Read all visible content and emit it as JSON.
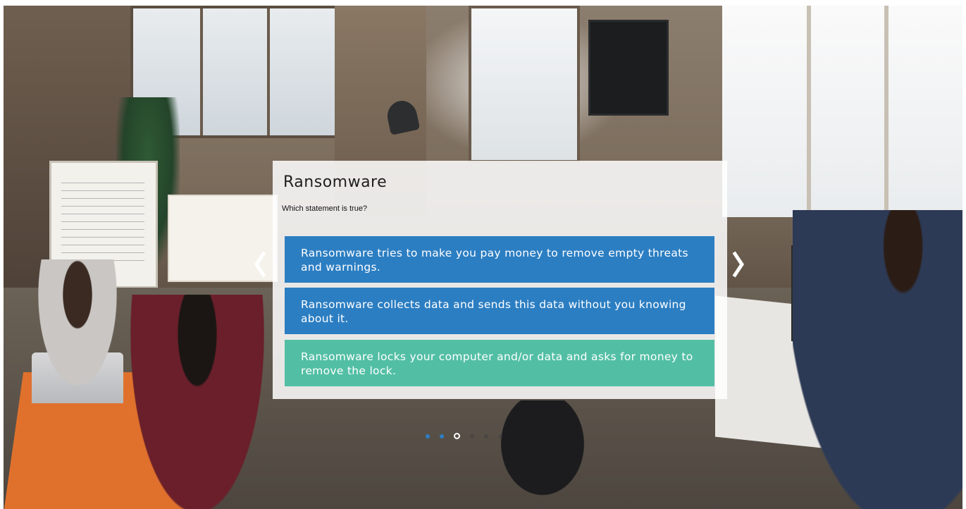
{
  "slide": {
    "title": "Ransomware",
    "question": "Which statement is true?",
    "answers": [
      {
        "label": "Ransomware tries to make you pay money to remove empty threats and warnings.",
        "color": "#2c7ec2"
      },
      {
        "label": "Ransomware collects data and sends this data without you knowing about it.",
        "color": "#2c7ec2"
      },
      {
        "label": "Ransomware locks your computer and/or data and asks for money to remove the lock.",
        "color": "#52bfa5"
      }
    ]
  },
  "navigation": {
    "prev_icon": "chevron-left-icon",
    "next_icon": "chevron-right-icon",
    "pager": {
      "total": 6,
      "current": 3,
      "completed": 2
    }
  },
  "colors": {
    "answer_default": "#2c7ec2",
    "answer_selected": "#52bfa5",
    "card_background": "#ffffff"
  }
}
